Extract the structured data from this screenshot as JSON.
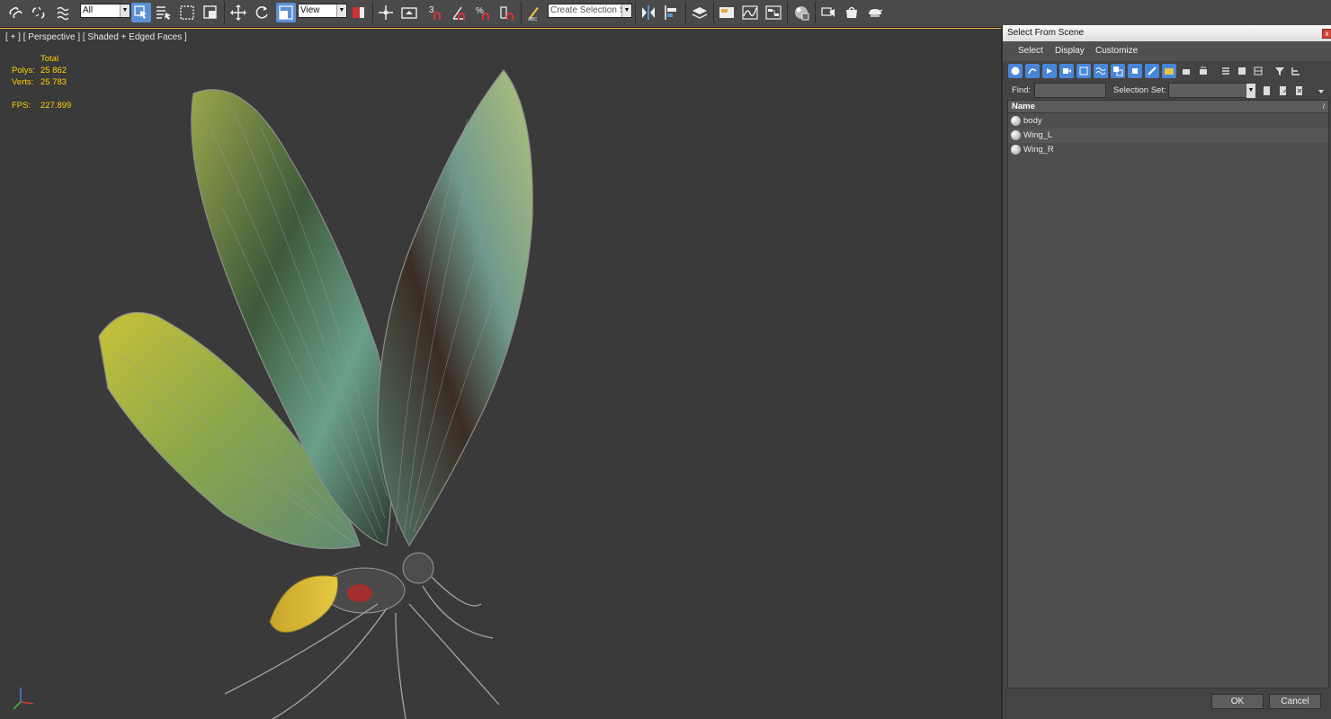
{
  "toolbar": {
    "selection_filter": "All",
    "reference_coord": "View",
    "named_selection_placeholder": "Create Selection Se",
    "icons": [
      "select-and-link-icon",
      "unlink-icon",
      "bind-space-warp-icon",
      "select-object-icon",
      "select-by-name-icon",
      "rect-selection-icon",
      "window-crossing-icon",
      "move-icon",
      "rotate-icon",
      "scale-icon",
      "pivot-center-icon",
      "manipulate-icon",
      "keyboard-override-icon",
      "snap-3d-icon",
      "angle-snap-icon",
      "percent-snap-icon",
      "spinner-snap-icon",
      "edit-named-selection-icon",
      "mirror-icon",
      "align-icon",
      "layer-manager-icon",
      "graphite-ribbon-icon",
      "curve-editor-icon",
      "schematic-view-icon",
      "material-editor-icon",
      "render-setup-icon",
      "rendered-frame-icon",
      "render-production-icon"
    ]
  },
  "viewport": {
    "label": "[ + ] [ Perspective ] [ Shaded + Edged Faces ]",
    "stats": {
      "total_label": "Total",
      "polys_label": "Polys:",
      "polys_value": "25 862",
      "verts_label": "Verts:",
      "verts_value": "25 783",
      "fps_label": "FPS:",
      "fps_value": "227.899"
    }
  },
  "dialog": {
    "title": "Select From Scene",
    "close_glyph": "x",
    "menu": [
      "Select",
      "Display",
      "Customize"
    ],
    "find_label": "Find:",
    "find_value": "",
    "selection_set_label": "Selection Set:",
    "selection_set_value": "",
    "column_header": "Name",
    "sort_glyph": "/",
    "objects": [
      "body",
      "Wing_L",
      "Wing_R"
    ],
    "ok_label": "OK",
    "cancel_label": "Cancel"
  },
  "colors": {
    "accent_blue": "#4a86d8",
    "stats_yellow": "#ffd400",
    "viewport_border": "#e2b24a",
    "viewport_bg": "#3a3a3a"
  }
}
